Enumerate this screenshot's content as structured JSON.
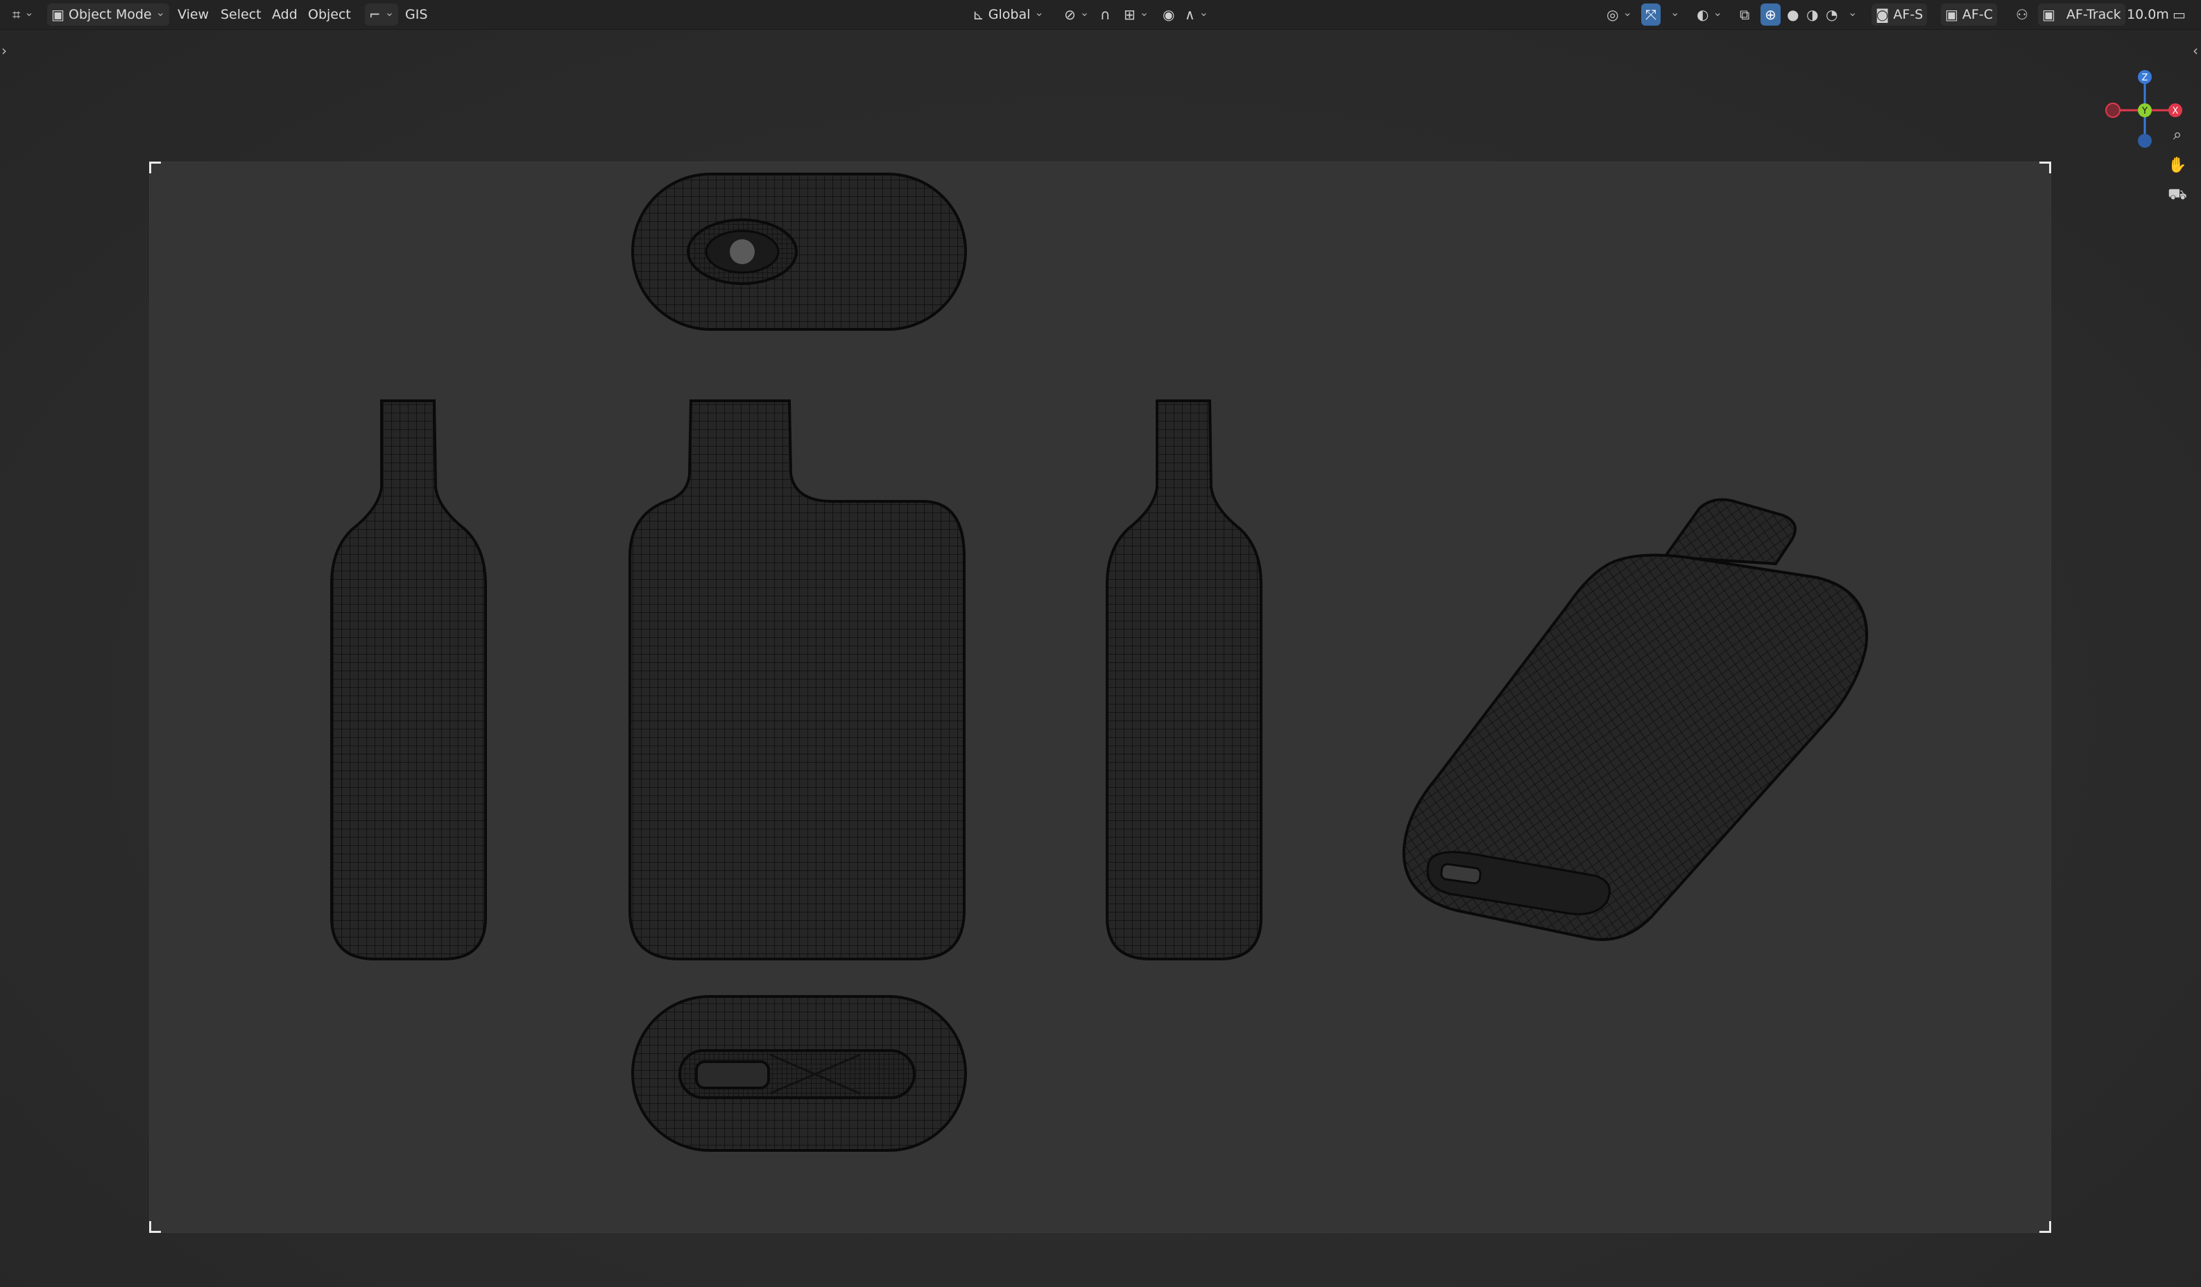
{
  "header": {
    "editor_type_icon": "viewport-icon",
    "mode": "Object Mode",
    "menus": [
      "View",
      "Select",
      "Add",
      "Object"
    ],
    "gis_label": "GIS",
    "orientation": "Global",
    "overlay_labels": {
      "af_s": "AF-S",
      "af_c": "AF-C",
      "af_track": "AF-Track"
    },
    "distance": "10.0m"
  },
  "gizmo": {
    "z": "Z",
    "y": "Y",
    "x": "X"
  },
  "colors": {
    "accent": "#3c6ea8",
    "axis_x": "#e2384c",
    "axis_y": "#8bd12f",
    "axis_z": "#3a7ad8",
    "mesh_fill": "#1e1e1e",
    "wire": "#0d0d0d"
  },
  "scene": {
    "views": [
      "top",
      "left",
      "front",
      "right",
      "perspective",
      "bottom"
    ]
  }
}
